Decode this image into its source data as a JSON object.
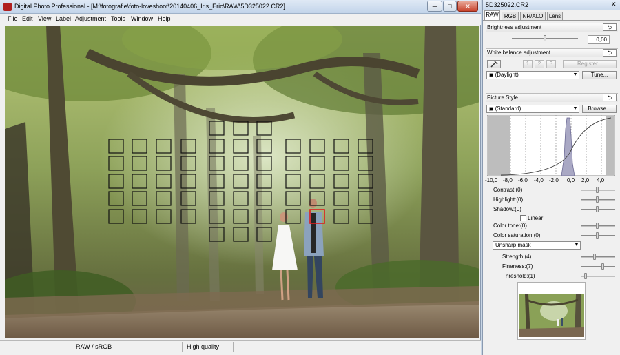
{
  "main_window": {
    "title": "Digital Photo Professional - [M:\\fotografie\\foto-loveshoot\\20140406_Iris_Eric\\RAW\\5D325022.CR2]",
    "minimize": "─",
    "maximize": "□",
    "close": "✕"
  },
  "menu": [
    "File",
    "Edit",
    "View",
    "Label",
    "Adjustment",
    "Tools",
    "Window",
    "Help"
  ],
  "status": {
    "color_space": "RAW / sRGB",
    "quality": "High quality"
  },
  "tool_palette": {
    "title": "5D325022.CR2",
    "close": "✕",
    "tabs": [
      "RAW",
      "RGB",
      "NR/ALO",
      "Lens"
    ],
    "brightness": {
      "title": "Brightness adjustment",
      "value": "0,00",
      "reset": "⮌"
    },
    "white_balance": {
      "title": "White balance adjustment",
      "reset": "⮌",
      "buttons": [
        "1",
        "2",
        "3"
      ],
      "register": "Register...",
      "preset": "(Daylight)",
      "tune": "Tune..."
    },
    "picture_style": {
      "title": "Picture Style",
      "reset": "⮌",
      "preset": "(Standard)",
      "browse": "Browse...",
      "axis_labels": [
        "-10,0",
        "-8,0",
        "-6,0",
        "-4,0",
        "-2,0",
        "0,0",
        "2,0",
        "4,0"
      ],
      "contrast": "Contrast:(0)",
      "highlight": "Highlight:(0)",
      "shadow": "Shadow:(0)",
      "linear": "Linear",
      "color_tone": "Color tone:(0)",
      "color_saturation": "Color saturation:(0)",
      "sharpening": "Unsharp mask",
      "strength": "Strength:(4)",
      "fineness": "Fineness:(7)",
      "threshold": "Threshold:(1)"
    }
  }
}
